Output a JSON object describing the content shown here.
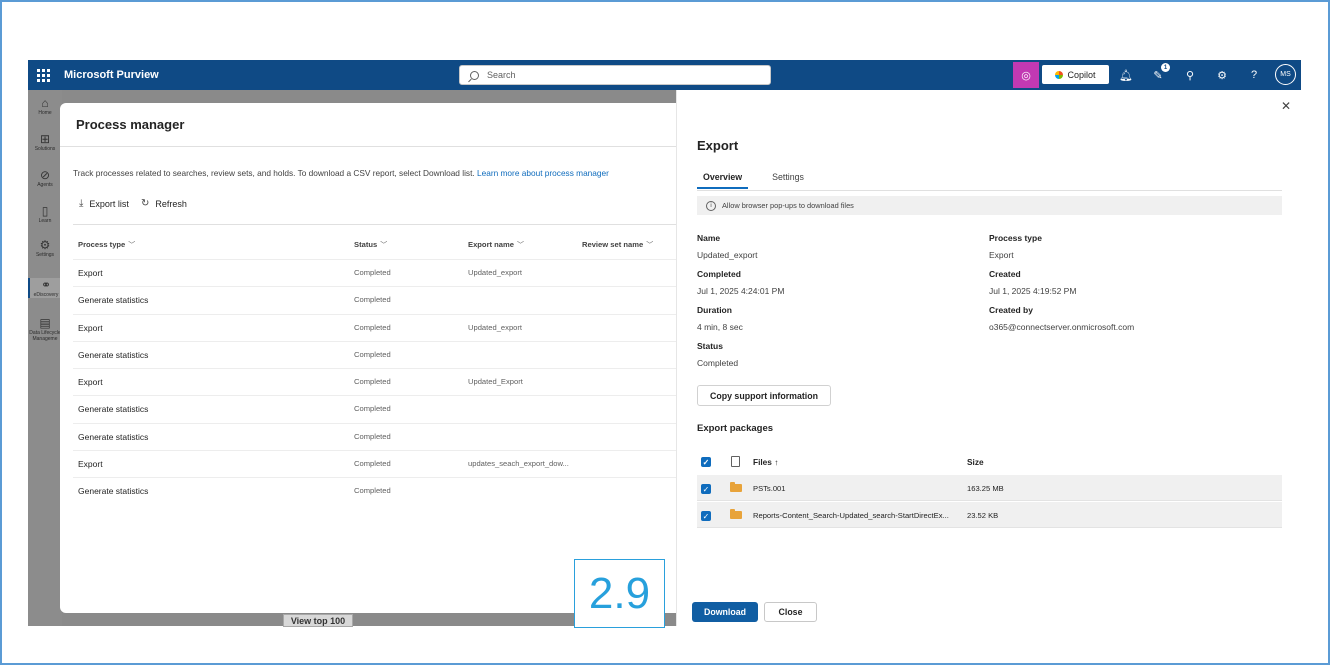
{
  "topbar": {
    "app_title": "Microsoft Purview",
    "search_placeholder": "Search",
    "copilot_label": "Copilot",
    "notification_count": "1",
    "avatar_initials": "MS",
    "brand_color": "#0f4a85"
  },
  "leftnav": {
    "items": [
      {
        "label": "Home",
        "icon": "home-icon"
      },
      {
        "label": "Solutions",
        "icon": "grid-icon"
      },
      {
        "label": "Agents",
        "icon": "agents-icon"
      },
      {
        "label": "Learn",
        "icon": "book-icon"
      },
      {
        "label": "Settings",
        "icon": "gear-icon"
      },
      {
        "label": "eDiscovery",
        "icon": "ediscovery-icon"
      },
      {
        "label": "Data Lifecycle Manageme",
        "icon": "lifecycle-icon"
      }
    ]
  },
  "background": {
    "view_top_label": "View top 100"
  },
  "process_manager": {
    "title": "Process manager",
    "description": "Track processes related to searches, review sets, and holds. To download a CSV report, select Download list.",
    "learn_more": "Learn more about process manager",
    "export_list_label": "Export list",
    "refresh_label": "Refresh",
    "columns": [
      "Process type",
      "Status",
      "Export name",
      "Review set name"
    ],
    "rows": [
      {
        "type": "Export",
        "status": "Completed",
        "export_name": "Updated_export"
      },
      {
        "type": "Generate statistics",
        "status": "Completed",
        "export_name": ""
      },
      {
        "type": "Export",
        "status": "Completed",
        "export_name": "Updated_export"
      },
      {
        "type": "Generate statistics",
        "status": "Completed",
        "export_name": ""
      },
      {
        "type": "Export",
        "status": "Completed",
        "export_name": "Updated_Export"
      },
      {
        "type": "Generate statistics",
        "status": "Completed",
        "export_name": ""
      },
      {
        "type": "Generate statistics",
        "status": "Completed",
        "export_name": ""
      },
      {
        "type": "Export",
        "status": "Completed",
        "export_name": "updates_seach_export_dow..."
      },
      {
        "type": "Generate statistics",
        "status": "Completed",
        "export_name": ""
      }
    ]
  },
  "export_panel": {
    "title": "Export",
    "tabs": [
      "Overview",
      "Settings"
    ],
    "info_banner": "Allow browser pop-ups to download files",
    "fields": {
      "name_label": "Name",
      "name_value": "Updated_export",
      "process_type_label": "Process type",
      "process_type_value": "Export",
      "completed_label": "Completed",
      "completed_value": "Jul 1, 2025 4:24:01 PM",
      "created_label": "Created",
      "created_value": "Jul 1, 2025 4:19:52 PM",
      "duration_label": "Duration",
      "duration_value": "4 min, 8 sec",
      "created_by_label": "Created by",
      "created_by_value": "o365@connectserver.onmicrosoft.com",
      "status_label": "Status",
      "status_value": "Completed"
    },
    "copy_support_label": "Copy support information",
    "packages_title": "Export packages",
    "packages_columns": {
      "files": "Files ↑",
      "size": "Size"
    },
    "packages": [
      {
        "name": "PSTs.001",
        "size": "163.25 MB"
      },
      {
        "name": "Reports-Content_Search-Updated_search-StartDirectEx...",
        "size": "23.52 KB"
      }
    ],
    "download_label": "Download",
    "close_label": "Close"
  },
  "step_badge": "2.9"
}
